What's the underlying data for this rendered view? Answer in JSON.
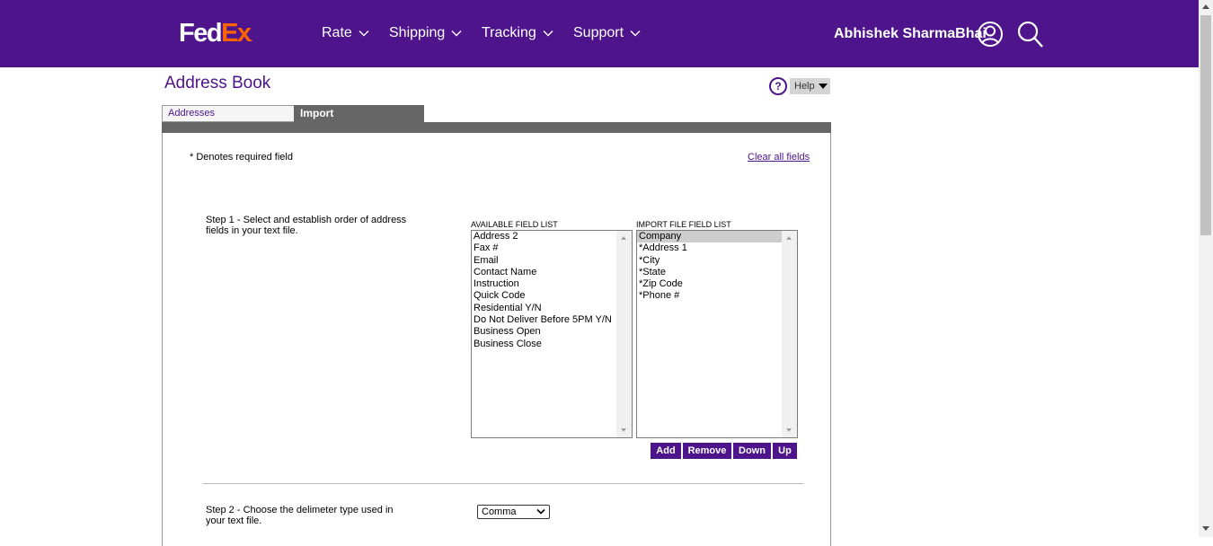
{
  "header": {
    "logo_fed": "Fed",
    "logo_ex": "Ex",
    "logo_dot": ".",
    "nav": [
      "Rate",
      "Shipping",
      "Tracking",
      "Support"
    ],
    "user_name": "Abhishek SharmaBhai",
    "colors": {
      "brand_purple": "#4d148c",
      "brand_orange": "#ff6200"
    },
    "icons": [
      "chevron-down-icon",
      "user-icon",
      "search-icon"
    ]
  },
  "page": {
    "title": "Address Book",
    "help_icon_text": "?",
    "help_label": "Help",
    "tabs": [
      "Addresses",
      "Import"
    ],
    "active_tab": "Import",
    "required_note": "* Denotes required field",
    "clear_link": "Clear all fields"
  },
  "step1": {
    "text": "Step 1 - Select and establish order of address fields in your text file.",
    "available_label": "AVAILABLE FIELD LIST",
    "available_fields": [
      "Address 2",
      "Fax #",
      "Email",
      "Contact Name",
      "Instruction",
      "Quick Code",
      "Residential Y/N",
      "Do Not Deliver Before 5PM Y/N",
      "Business Open",
      "Business Close"
    ],
    "import_label": "IMPORT FILE FIELD LIST",
    "import_fields": [
      "Company",
      "*Address 1",
      "*City",
      "*State",
      "*Zip Code",
      "*Phone #"
    ],
    "selected_import_field": "Company",
    "buttons": {
      "add": "Add",
      "remove": "Remove",
      "down": "Down",
      "up": "Up"
    }
  },
  "step2": {
    "text": "Step 2 - Choose the delimeter type used in your text file.",
    "delimiter_value": "Comma"
  }
}
